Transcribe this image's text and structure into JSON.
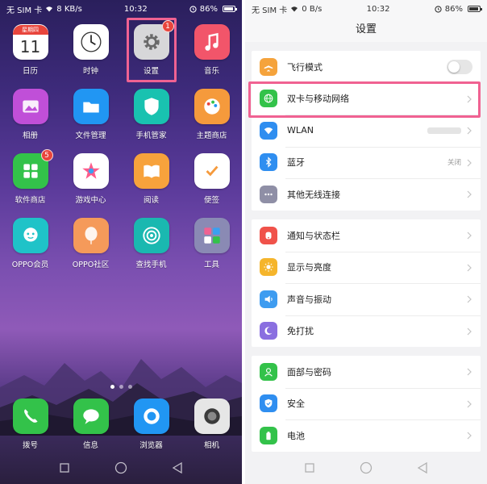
{
  "home": {
    "status": {
      "carrier": "无 SIM 卡",
      "speed": "8 KB/s",
      "time": "10:32",
      "battery": "86%"
    },
    "apps": [
      {
        "label": "日历",
        "icon": "calendar-icon",
        "color": "#ffffff",
        "cal_month": "星期四",
        "cal_day": "11"
      },
      {
        "label": "时钟",
        "icon": "clock-icon",
        "color": "#ffffff"
      },
      {
        "label": "设置",
        "icon": "gear-icon",
        "color": "#d7d7d9",
        "badge": "1"
      },
      {
        "label": "音乐",
        "icon": "music-note-icon",
        "color": "#f2556a"
      },
      {
        "label": "相册",
        "icon": "photo-icon",
        "color": "#c04fd8"
      },
      {
        "label": "文件管理",
        "icon": "folder-icon",
        "color": "#2196f3"
      },
      {
        "label": "手机管家",
        "icon": "shield-icon",
        "color": "#19c2b0"
      },
      {
        "label": "主题商店",
        "icon": "palette-icon",
        "color": "#f59a3c"
      },
      {
        "label": "软件商店",
        "icon": "app-grid-icon",
        "color": "#33c24a",
        "badge": "5"
      },
      {
        "label": "游戏中心",
        "icon": "star-icon",
        "color": "#ffffff"
      },
      {
        "label": "阅读",
        "icon": "book-icon",
        "color": "#f7a23c"
      },
      {
        "label": "便签",
        "icon": "note-check-icon",
        "color": "#ffffff"
      },
      {
        "label": "OPPO会员",
        "icon": "mascot-icon",
        "color": "#1fc3c8"
      },
      {
        "label": "OPPO社区",
        "icon": "balloon-icon",
        "color": "#f59a5a"
      },
      {
        "label": "查找手机",
        "icon": "radar-icon",
        "color": "#1ab8b0"
      },
      {
        "label": "工具",
        "icon": "tools-folder-icon",
        "color": "#8a8ab4"
      }
    ],
    "dock": [
      {
        "label": "拨号",
        "icon": "phone-icon",
        "color": "#33c24a"
      },
      {
        "label": "信息",
        "icon": "message-icon",
        "color": "#33c24a"
      },
      {
        "label": "浏览器",
        "icon": "browser-icon",
        "color": "#2196f3"
      },
      {
        "label": "相机",
        "icon": "camera-icon",
        "color": "#e6e6e6"
      }
    ]
  },
  "settings": {
    "status": {
      "carrier": "无 SIM 卡",
      "speed": "0 B/s",
      "time": "10:32",
      "battery": "86%"
    },
    "title": "设置",
    "groups": [
      [
        {
          "label": "飞行模式",
          "icon": "airplane-icon",
          "color": "#f5a33c",
          "control": "toggle"
        },
        {
          "label": "双卡与移动网络",
          "icon": "globe-icon",
          "color": "#33c24a",
          "control": "chevron"
        },
        {
          "label": "WLAN",
          "icon": "wifi-icon",
          "color": "#2f8ef0",
          "control": "blurred"
        },
        {
          "label": "蓝牙",
          "icon": "bluetooth-icon",
          "color": "#2f8ef0",
          "control": "value",
          "value": "关闭"
        },
        {
          "label": "其他无线连接",
          "icon": "more-dots-icon",
          "color": "#8f8fa6",
          "control": "chevron"
        }
      ],
      [
        {
          "label": "通知与状态栏",
          "icon": "notification-icon",
          "color": "#f0524a",
          "control": "chevron"
        },
        {
          "label": "显示与亮度",
          "icon": "sun-icon",
          "color": "#f5b52c",
          "control": "chevron"
        },
        {
          "label": "声音与振动",
          "icon": "speaker-icon",
          "color": "#3e9cf0",
          "control": "chevron"
        },
        {
          "label": "免打扰",
          "icon": "moon-icon",
          "color": "#8a6fe0",
          "control": "chevron"
        }
      ],
      [
        {
          "label": "面部与密码",
          "icon": "face-icon",
          "color": "#33c24a",
          "control": "chevron"
        },
        {
          "label": "安全",
          "icon": "security-shield-icon",
          "color": "#2f8ef0",
          "control": "chevron"
        },
        {
          "label": "电池",
          "icon": "battery-icon",
          "color": "#33c24a",
          "control": "chevron"
        }
      ]
    ]
  }
}
